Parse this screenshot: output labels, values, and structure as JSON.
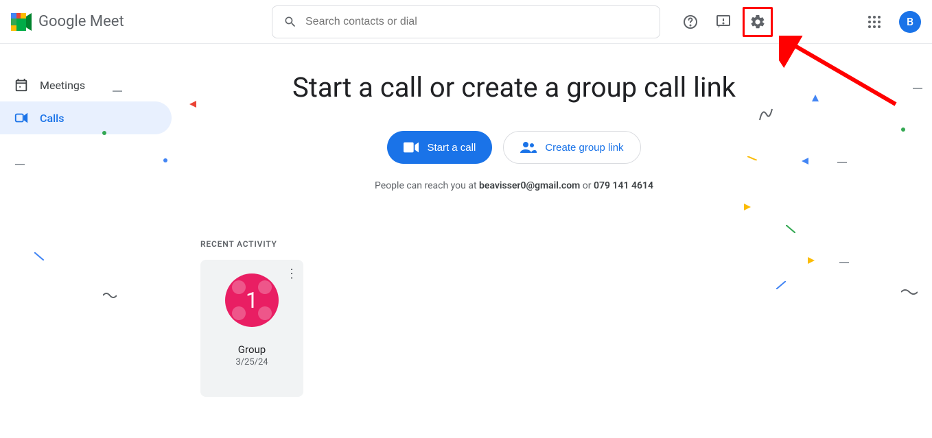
{
  "brand": {
    "name": "Google Meet"
  },
  "search": {
    "placeholder": "Search contacts or dial"
  },
  "avatar": {
    "initial": "B"
  },
  "sidebar": {
    "items": [
      {
        "label": "Meetings"
      },
      {
        "label": "Calls"
      }
    ]
  },
  "hero": {
    "title": "Start a call or create a group call link",
    "start_label": "Start a call",
    "group_label": "Create group link",
    "reach_prefix": "People can reach you at ",
    "reach_email": "beavisser0@gmail.com",
    "reach_or": " or ",
    "reach_phone": "079 141 4614"
  },
  "recent": {
    "heading": "RECENT ACTIVITY",
    "items": [
      {
        "badge": "1",
        "name": "Group",
        "date": "3/25/24"
      }
    ]
  },
  "annotation": {
    "highlight": "settings",
    "arrow_color": "#ff0000"
  }
}
